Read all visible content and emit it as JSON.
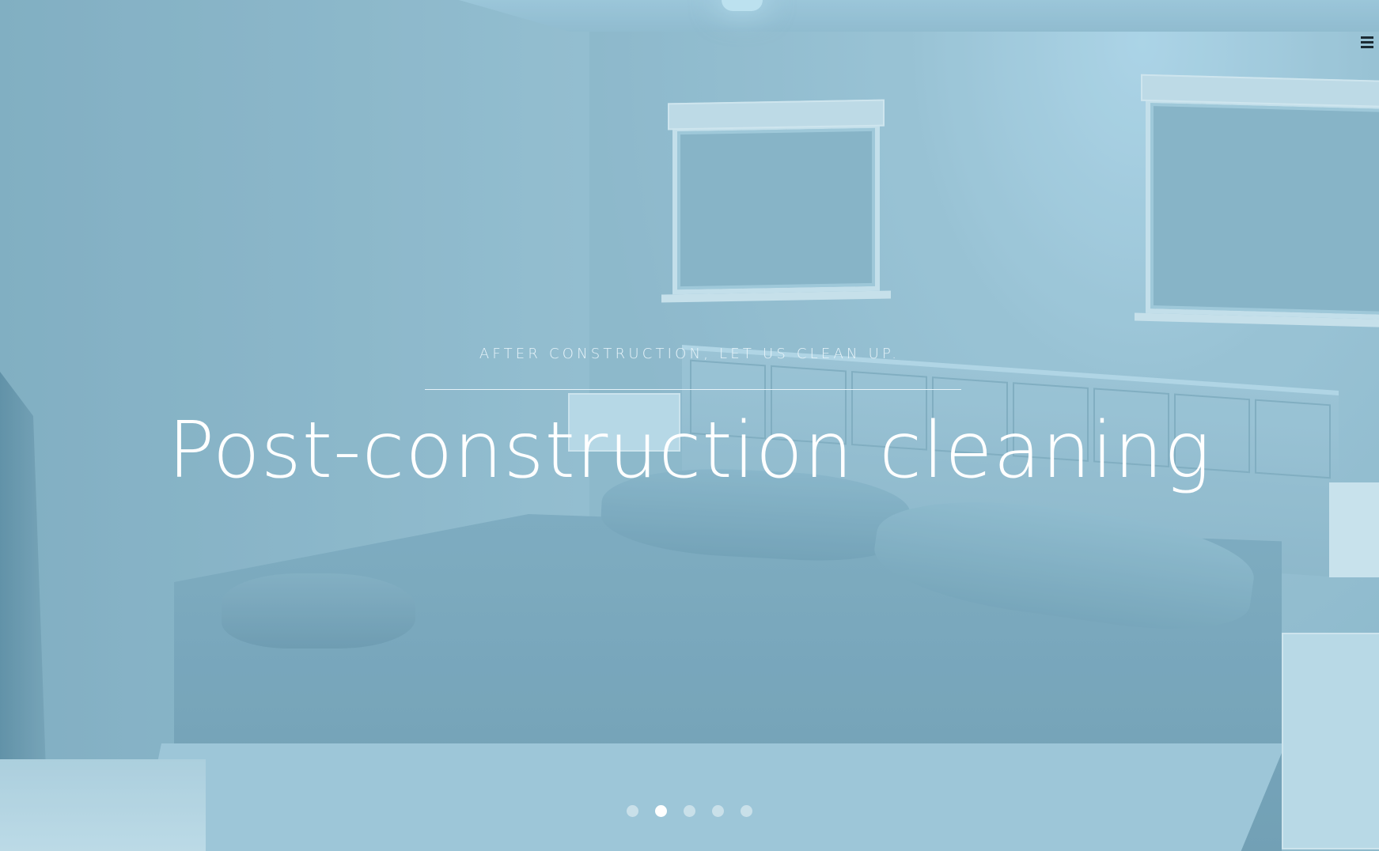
{
  "hero": {
    "subtitle": "AFTER CONSTRUCTION, LET US CLEAN UP.",
    "title": "Post-construction cleaning"
  },
  "nav": {
    "menu_icon": "hamburger-menu-icon"
  },
  "slider": {
    "slide_count": 5,
    "active_index": 1,
    "dots": [
      {
        "active": false
      },
      {
        "active": true
      },
      {
        "active": false
      },
      {
        "active": false
      },
      {
        "active": false
      }
    ]
  },
  "colors": {
    "overlay_tint": "#8fb8c9",
    "title_text": "#ffffff",
    "menu_icon": "#1b2a33"
  }
}
